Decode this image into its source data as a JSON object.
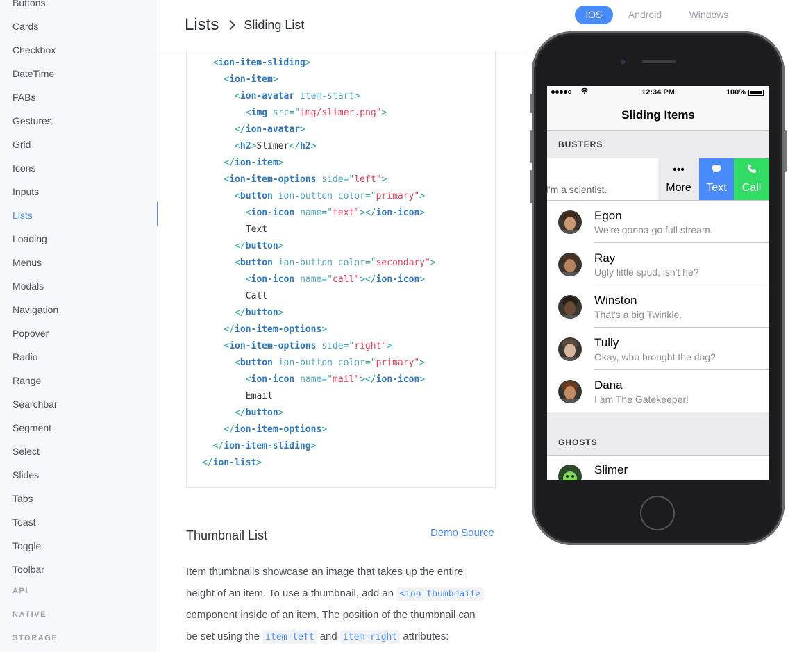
{
  "sidebar": {
    "items": [
      "Buttons",
      "Cards",
      "Checkbox",
      "DateTime",
      "FABs",
      "Gestures",
      "Grid",
      "Icons",
      "Inputs",
      "Lists",
      "Loading",
      "Menus",
      "Modals",
      "Navigation",
      "Popover",
      "Radio",
      "Range",
      "Searchbar",
      "Segment",
      "Select",
      "Slides",
      "Tabs",
      "Toast",
      "Toggle",
      "Toolbar"
    ],
    "active": "Lists",
    "sections": [
      "API",
      "NATIVE",
      "STORAGE"
    ]
  },
  "breadcrumb": {
    "section": "Lists",
    "page": "Sliding List"
  },
  "code": [
    [
      "  ",
      "<",
      "ion-item-sliding",
      "",
      "",
      ">"
    ],
    [
      "    ",
      "<",
      "ion-item",
      "",
      "",
      ">"
    ],
    [
      "      ",
      "<",
      "ion-avatar",
      "item-start",
      "",
      ">"
    ],
    [
      "        ",
      "<",
      "img",
      "src",
      "img/slimer.png",
      ">"
    ],
    [
      "      ",
      "</",
      "ion-avatar",
      "",
      "",
      ">"
    ],
    [
      "      ",
      "<",
      "h2",
      "",
      "",
      ">",
      "Slimer",
      "h2"
    ],
    [
      "    ",
      "</",
      "ion-item",
      "",
      "",
      ">"
    ],
    [
      "    ",
      "<",
      "ion-item-options",
      "side",
      "left",
      ">"
    ],
    [
      "      ",
      "<",
      "button",
      "ion-button color",
      "primary",
      ">"
    ],
    [
      "        ",
      "<",
      "ion-icon",
      "name",
      "text",
      "></",
      "",
      "ion-icon"
    ],
    [
      "        ",
      "",
      "",
      "",
      "",
      "",
      "Text"
    ],
    [
      "      ",
      "</",
      "button",
      "",
      "",
      ">"
    ],
    [
      "      ",
      "<",
      "button",
      "ion-button color",
      "secondary",
      ">"
    ],
    [
      "        ",
      "<",
      "ion-icon",
      "name",
      "call",
      "></",
      "",
      "ion-icon"
    ],
    [
      "        ",
      "",
      "",
      "",
      "",
      "",
      "Call"
    ],
    [
      "      ",
      "</",
      "button",
      "",
      "",
      ">"
    ],
    [
      "    ",
      "</",
      "ion-item-options",
      "",
      "",
      ">"
    ],
    [
      "    ",
      "<",
      "ion-item-options",
      "side",
      "right",
      ">"
    ],
    [
      "      ",
      "<",
      "button",
      "ion-button color",
      "primary",
      ">"
    ],
    [
      "        ",
      "<",
      "ion-icon",
      "name",
      "mail",
      "></",
      "",
      "ion-icon"
    ],
    [
      "        ",
      "",
      "",
      "",
      "",
      "",
      "Email"
    ],
    [
      "      ",
      "</",
      "button",
      "",
      "",
      ">"
    ],
    [
      "    ",
      "</",
      "ion-item-options",
      "",
      "",
      ">"
    ],
    [
      "  ",
      "</",
      "ion-item-sliding",
      "",
      "",
      ">"
    ],
    [
      "",
      "</",
      "ion-list",
      "",
      "",
      ">"
    ]
  ],
  "thumbnail_section": {
    "title": "Thumbnail List",
    "demo_link": "Demo Source",
    "para_1": "Item thumbnails showcase an image that takes up the entire",
    "para_2a": "height of an item. To use a thumbnail, add an",
    "code_thumbnail": "<ion-thumbnail>",
    "para_3": "component inside of an item. The position of the thumbnail can",
    "para_4a": "be set using the",
    "code_left": "item-left",
    "para_4b": "and",
    "code_right": "item-right",
    "para_4c": "attributes:"
  },
  "platform_tabs": {
    "ios": "iOS",
    "android": "Android",
    "windows": "Windows",
    "active": "iOS"
  },
  "phone": {
    "status": {
      "time": "12:34 PM",
      "battery": "100%"
    },
    "nav_title": "Sliding Items",
    "header_busters": "BUSTERS",
    "header_ghosts": "GHOSTS",
    "sliding_item": {
      "text": "I'm a scientist.",
      "options": [
        {
          "label": "More",
          "icon": "more-icon",
          "glyph": "•••"
        },
        {
          "label": "Text",
          "icon": "chat-bubble-icon",
          "glyph": "💬",
          "color": "#4a8bfc"
        },
        {
          "label": "Call",
          "icon": "phone-icon",
          "glyph": "✆",
          "color": "#32db64"
        }
      ]
    },
    "people": [
      {
        "name": "Egon",
        "message": "We're gonna go full stream."
      },
      {
        "name": "Ray",
        "message": "Ugly little spud, isn't he?"
      },
      {
        "name": "Winston",
        "message": "That's a big Twinkie."
      },
      {
        "name": "Tully",
        "message": "Okay, who brought the dog?"
      },
      {
        "name": "Dana",
        "message": "I am The Gatekeeper!"
      }
    ],
    "ghost": {
      "name": "Slimer"
    }
  },
  "colors": {
    "accent": "#4a8bfc",
    "call": "#32db64",
    "tag": "#2f78b9",
    "value": "#e0425a"
  }
}
